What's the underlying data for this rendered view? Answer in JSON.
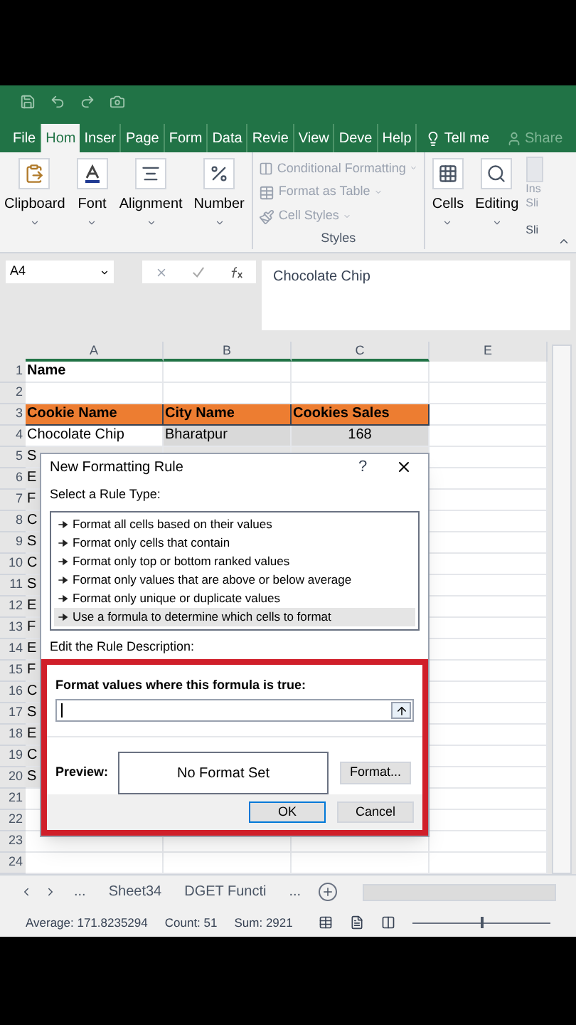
{
  "ribbon_tabs": [
    {
      "label": "File",
      "selected": false
    },
    {
      "label": "Hom",
      "selected": true
    },
    {
      "label": "Inser",
      "selected": false
    },
    {
      "label": "Page",
      "selected": false
    },
    {
      "label": "Form",
      "selected": false
    },
    {
      "label": "Data",
      "selected": false
    },
    {
      "label": "Revie",
      "selected": false
    },
    {
      "label": "View",
      "selected": false
    },
    {
      "label": "Deve",
      "selected": false
    },
    {
      "label": "Help",
      "selected": false
    }
  ],
  "tell_me": "Tell me",
  "share": "Share",
  "ribbon_groups": [
    {
      "kind": "button",
      "label": "Clipboard"
    },
    {
      "kind": "button",
      "label": "Font"
    },
    {
      "kind": "button",
      "label": "Alignment"
    },
    {
      "kind": "button",
      "label": "Number"
    },
    {
      "kind": "styles",
      "label": "Styles",
      "items": [
        "Conditional Formatting",
        "Format as Table",
        "Cell Styles"
      ]
    },
    {
      "kind": "button",
      "label": "Cells"
    },
    {
      "kind": "button",
      "label": "Editing"
    },
    {
      "kind": "cut",
      "label": "Sli",
      "items": [
        "Ins",
        "Sli"
      ]
    }
  ],
  "name_box": "A4",
  "formula": "Chocolate Chip",
  "columns": [
    "A",
    "B",
    "C",
    "E"
  ],
  "rows": [
    {
      "number": "1",
      "kind": "title",
      "cells": [
        "Name"
      ]
    },
    {
      "number": "2",
      "kind": "blank"
    },
    {
      "number": "3",
      "kind": "header",
      "cells": [
        "Cookie Name",
        "City Name",
        "Cookies Sales"
      ]
    },
    {
      "number": "4",
      "kind": "data",
      "cells": [
        "Chocolate Chip",
        "Bharatpur",
        "168"
      ]
    },
    {
      "number": "5",
      "kind": "covered",
      "cells": [
        "S"
      ]
    },
    {
      "number": "6",
      "kind": "covered",
      "cells": [
        "E"
      ]
    },
    {
      "number": "7",
      "kind": "covered",
      "cells": [
        "F"
      ]
    },
    {
      "number": "8",
      "kind": "covered",
      "cells": [
        "C"
      ]
    },
    {
      "number": "9",
      "kind": "covered",
      "cells": [
        "S"
      ]
    },
    {
      "number": "10",
      "kind": "covered",
      "cells": [
        "C"
      ]
    },
    {
      "number": "11",
      "kind": "covered",
      "cells": [
        "S"
      ]
    },
    {
      "number": "12",
      "kind": "covered",
      "cells": [
        "E"
      ]
    },
    {
      "number": "13",
      "kind": "covered",
      "cells": [
        "F"
      ]
    },
    {
      "number": "14",
      "kind": "covered",
      "cells": [
        "E"
      ]
    },
    {
      "number": "15",
      "kind": "covered",
      "cells": [
        "F"
      ]
    },
    {
      "number": "16",
      "kind": "covered",
      "cells": [
        "C"
      ]
    },
    {
      "number": "17",
      "kind": "covered",
      "cells": [
        "S"
      ]
    },
    {
      "number": "18",
      "kind": "covered",
      "cells": [
        "E"
      ]
    },
    {
      "number": "19",
      "kind": "covered",
      "cells": [
        "C"
      ]
    },
    {
      "number": "20",
      "kind": "covered",
      "cells": [
        "S"
      ]
    },
    {
      "number": "21",
      "kind": "blank_covered"
    },
    {
      "number": "22",
      "kind": "blank_covered"
    },
    {
      "number": "23",
      "kind": "blank"
    },
    {
      "number": "24",
      "kind": "blank"
    }
  ],
  "sheet_tabs": [
    {
      "label": "...",
      "selected": false
    },
    {
      "label": "Sheet34",
      "selected": false
    },
    {
      "label": "DGET Functi",
      "selected": false
    },
    {
      "label": "...",
      "selected": false
    }
  ],
  "status": [
    "Average: 171.8235294",
    "Count: 51",
    "Sum: 2921"
  ],
  "zoom": {
    "level": 0.5
  },
  "dialog": {
    "title": "New Formatting Rule",
    "help": "?",
    "rule_type_label": "Select a Rule Type:",
    "rule_types": [
      {
        "label": "Format all cells based on their values",
        "selected": false
      },
      {
        "label": "Format only cells that contain",
        "selected": false
      },
      {
        "label": "Format only top or bottom ranked values",
        "selected": false
      },
      {
        "label": "Format only values that are above or below average",
        "selected": false
      },
      {
        "label": "Format only unique or duplicate values",
        "selected": false
      },
      {
        "label": "Use a formula to determine which cells to format",
        "selected": true
      }
    ],
    "description_label": "Edit the Rule Description:",
    "formula_label": "Format values where this formula is true:",
    "preview_label": "Preview:",
    "preview_text": "No Format Set",
    "format_button": "Format...",
    "ok": "OK",
    "cancel": "Cancel",
    "highlighted": true
  }
}
